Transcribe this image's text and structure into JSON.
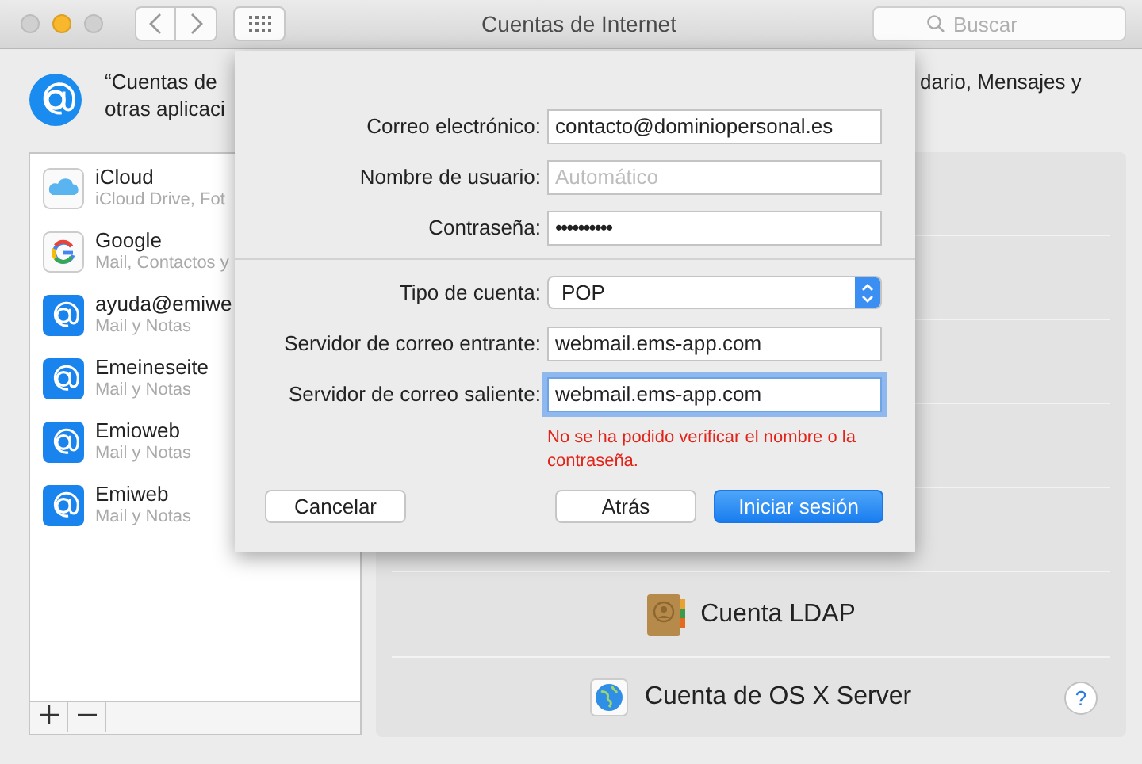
{
  "window": {
    "title": "Cuentas de Internet"
  },
  "toolbar": {
    "search_placeholder": "Buscar"
  },
  "intro": {
    "left_lines": [
      "“Cuentas de",
      "otras aplicaci"
    ],
    "right_lines": [
      "dario, Mensajes y"
    ]
  },
  "accounts": [
    {
      "kind": "icloud",
      "name": "iCloud",
      "detail": "iCloud Drive, Fot"
    },
    {
      "kind": "google",
      "name": "Google",
      "detail": "Mail, Contactos y"
    },
    {
      "kind": "at",
      "name": "ayuda@emiwe",
      "detail": "Mail y Notas"
    },
    {
      "kind": "at",
      "name": "Emeineseite",
      "detail": "Mail y Notas"
    },
    {
      "kind": "at",
      "name": "Emioweb",
      "detail": "Mail y Notas"
    },
    {
      "kind": "at",
      "name": "Emiweb",
      "detail": "Mail y Notas"
    }
  ],
  "list_buttons": [
    {
      "kind": "add"
    },
    {
      "kind": "remove"
    }
  ],
  "providers": [
    {
      "kind": "ldap",
      "label": "Cuenta LDAP"
    },
    {
      "kind": "server",
      "label": "Cuenta de OS X Server"
    }
  ],
  "help": "?",
  "sheet": {
    "fields": [
      {
        "kind": "text",
        "label": "Correo electrónico:",
        "value": "contacto@dominiopersonal.es",
        "focused": false
      },
      {
        "kind": "text",
        "label": "Nombre de usuario:",
        "placeholder": "Automático",
        "focused": false
      },
      {
        "kind": "password",
        "label": "Contraseña:",
        "value": "••••••••••",
        "focused": false
      },
      {
        "kind": "separator"
      },
      {
        "kind": "select",
        "label": "Tipo de cuenta:",
        "value": "POP",
        "focused": false
      },
      {
        "kind": "text",
        "label": "Servidor de correo entrante:",
        "value": "webmail.ems-app.com",
        "focused": false
      },
      {
        "kind": "text",
        "label": "Servidor de correo saliente:",
        "value": "webmail.ems-app.com",
        "focused": true
      }
    ],
    "error": "No se ha podido verificar el nombre o la contraseña.",
    "buttons": [
      {
        "label": "Cancelar",
        "primary": false
      },
      {
        "label": "Atrás",
        "primary": false
      },
      {
        "label": "Iniciar sesión",
        "primary": true
      }
    ]
  }
}
